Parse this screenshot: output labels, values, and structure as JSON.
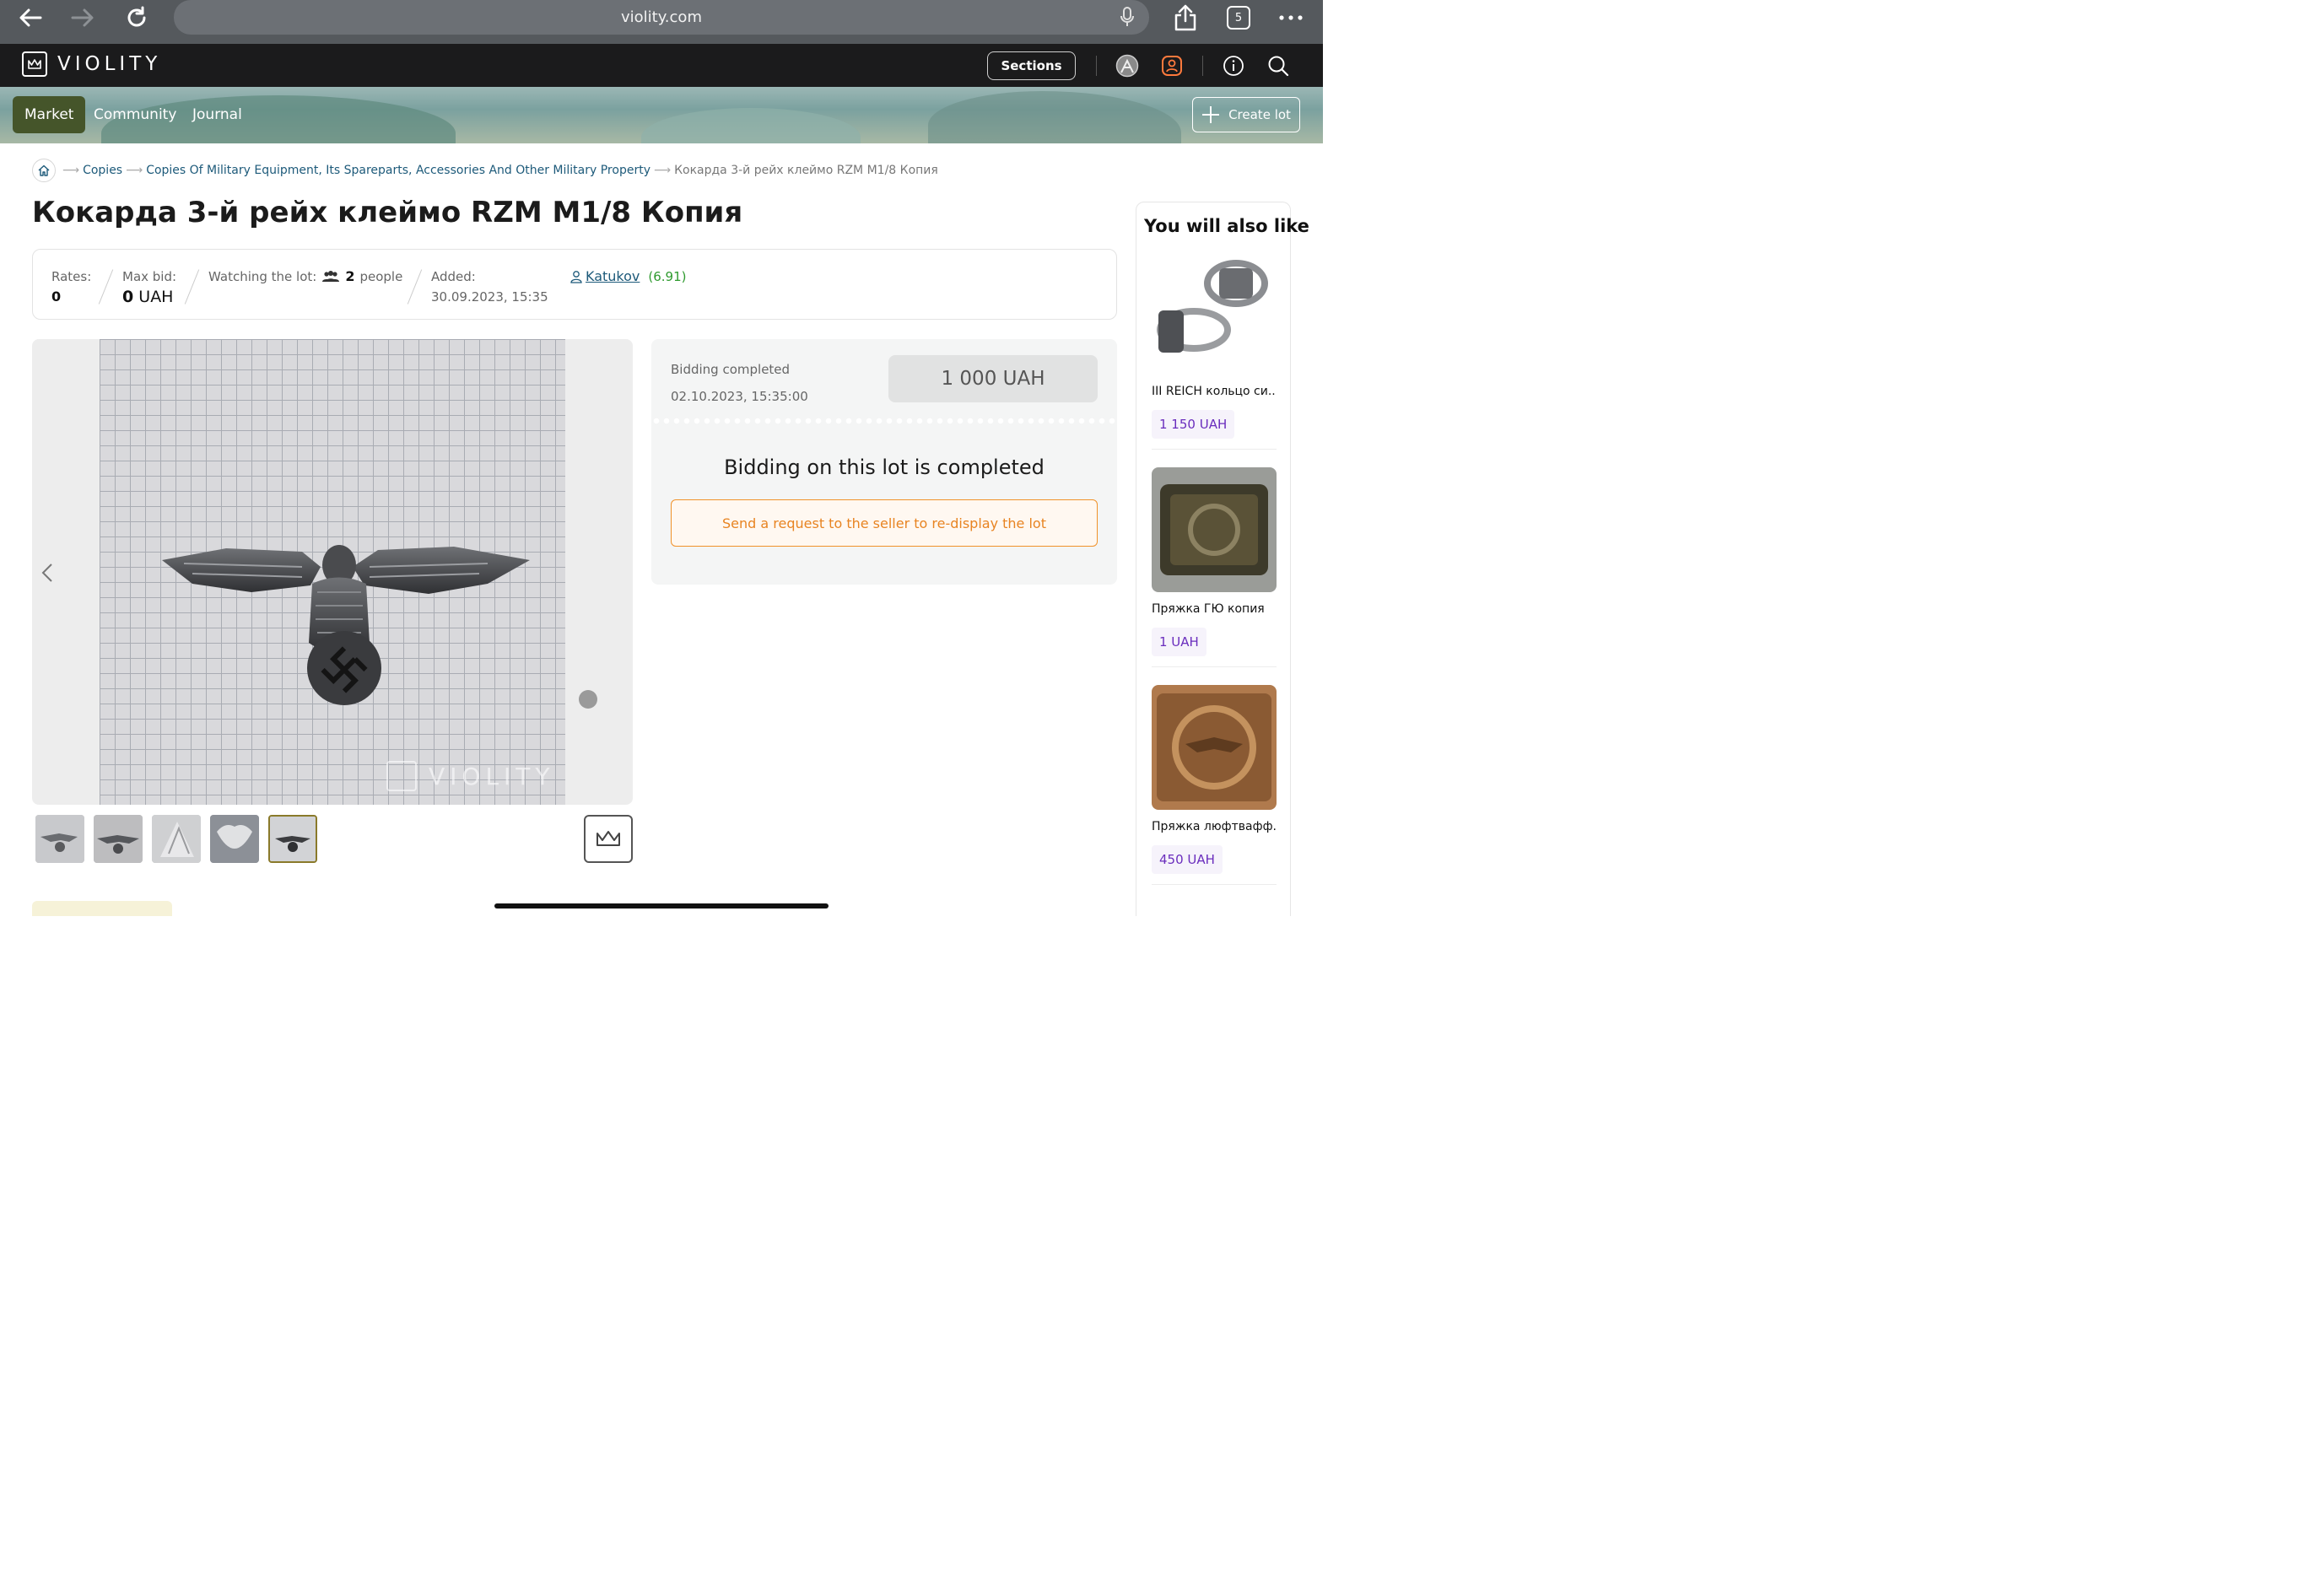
{
  "browser": {
    "url": "violity.com",
    "tab_count": "5"
  },
  "header": {
    "logo_text": "VIOLITY",
    "sections_label": "Sections"
  },
  "nav": {
    "tabs": [
      {
        "label": "Market",
        "active": true
      },
      {
        "label": "Community",
        "active": false
      },
      {
        "label": "Journal",
        "active": false
      }
    ],
    "create_lot_label": "Create lot"
  },
  "breadcrumb": {
    "items": [
      "Copies",
      "Copies Of Military Equipment, Its Spareparts, Accessories And Other Military Property"
    ],
    "current": "Кокарда 3-й рейх клеймо RZM M1/8 Копия"
  },
  "lot": {
    "title": "Кокарда 3-й рейх клеймо RZM M1/8 Копия",
    "rates_label": "Rates:",
    "rates_value": "0",
    "max_bid_label": "Max bid:",
    "max_bid_value": "0",
    "max_bid_currency": "UAH",
    "watching_label": "Watching the lot:",
    "watching_count": "2",
    "watching_unit": "people",
    "added_label": "Added:",
    "added_value": "30.09.2023, 15:35",
    "seller_name": "Katukov",
    "seller_rating": "(6.91)"
  },
  "gallery": {
    "watermark": "VIOLITY",
    "thumbnail_count": 5,
    "selected_thumbnail": 5
  },
  "bidding": {
    "status_label": "Bidding completed",
    "end_time": "02.10.2023, 15:35:00",
    "final_price": "1 000 UAH",
    "completed_message": "Bidding on this lot is completed",
    "request_button": "Send a request to the seller to re-display the lot"
  },
  "recommendations": {
    "title": "You will also like",
    "items": [
      {
        "name": "III REICH кольцо си...",
        "price": "1 150 UAH"
      },
      {
        "name": "Пряжка ГЮ копия",
        "price": "1 UAH"
      },
      {
        "name": "Пряжка люфтвафф...",
        "price": "450 UAH"
      }
    ]
  },
  "colors": {
    "accent_orange": "#e88422",
    "active_tab": "#45552a",
    "price_purple": "#6a2dbd",
    "seller_rating_green": "#2e9a2e",
    "link_blue": "#1d5a7a"
  }
}
